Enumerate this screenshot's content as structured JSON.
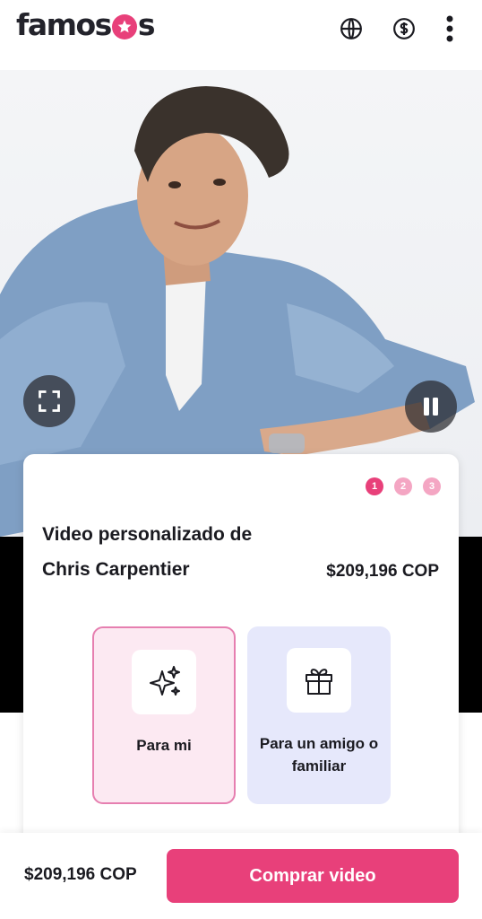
{
  "header": {
    "logo_text": "famosos",
    "icons": [
      "globe-icon",
      "currency-icon",
      "more-vertical-icon"
    ]
  },
  "media": {
    "fullscreen_icon": "fullscreen-icon",
    "pause_icon": "pause-icon"
  },
  "card": {
    "steps": [
      "1",
      "2",
      "3"
    ],
    "active_step": 1,
    "title": "Video personalizado de Chris Carpentier",
    "price": "$209,196 COP",
    "options": [
      {
        "label": "Para mi",
        "icon": "sparkles-icon"
      },
      {
        "label": "Para un amigo o familiar",
        "icon": "gift-icon"
      }
    ]
  },
  "footer": {
    "price": "$209,196 COP",
    "buy_label": "Comprar video"
  },
  "colors": {
    "brand": "#e8407a",
    "option_selected_bg": "#fce9f2",
    "option_alt_bg": "#e6e8fb"
  }
}
